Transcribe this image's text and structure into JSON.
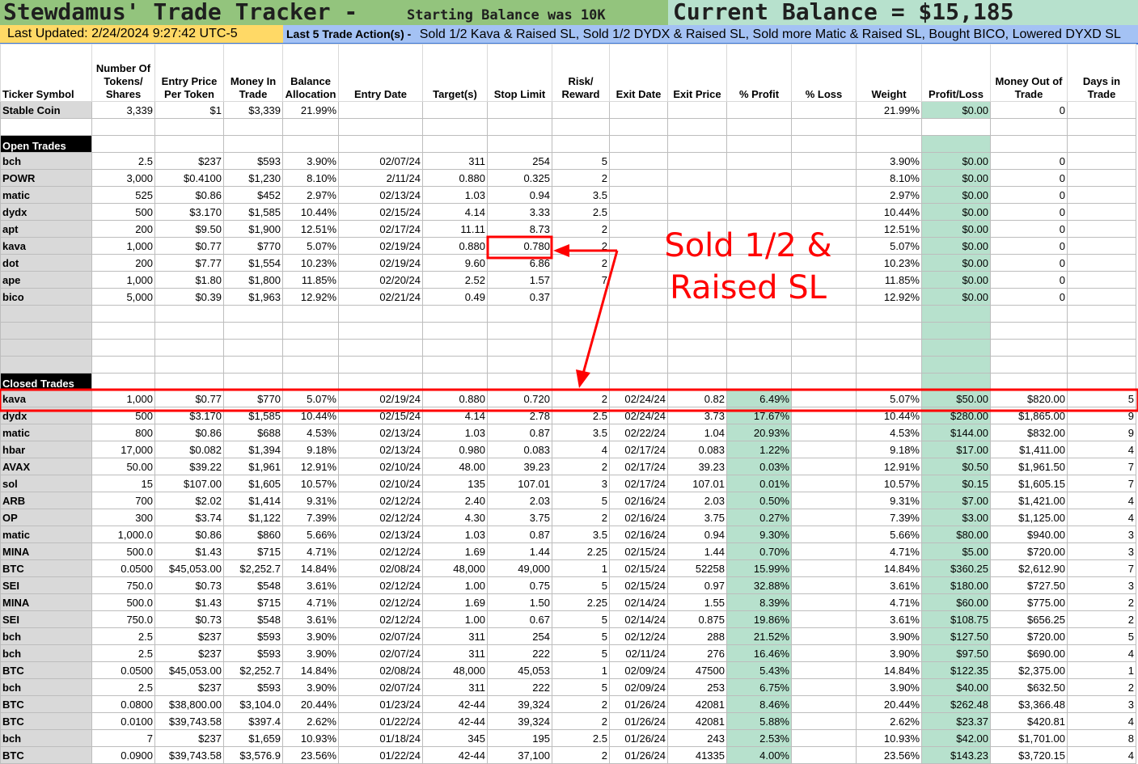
{
  "title": "Stewdamus' Trade Tracker -",
  "subtitle": "Starting Balance was 10K",
  "current_balance": "Current Balance = $15,185",
  "last_updated": "Last Updated:  2/24/2024 9:27:42  UTC-5",
  "actions_label": "Last 5 Trade Action(s) -",
  "actions_text": "Sold 1/2 Kava & Raised SL, Sold 1/2 DYDX & Raised SL, Sold more Matic & Raised SL, Bought BICO, Lowered DYXD SL",
  "annotation": "Sold 1/2 & Raised SL",
  "colors": {
    "title_bg": "#93c47d",
    "balance_bg": "#b7e1cd",
    "updated_bg": "#ffd966",
    "actions_bg": "#a4c2f4",
    "profit_bg": "#b7e1cd",
    "annotation": "#ff0000"
  },
  "headers": [
    "Ticker Symbol",
    "Number Of Tokens/ Shares",
    "Entry Price Per Token",
    "Money In Trade",
    "Balance Allocation",
    "Entry Date",
    "Target(s)",
    "Stop Limit",
    "Risk/ Reward",
    "Exit Date",
    "Exit Price",
    "% Profit",
    "% Loss",
    "Weight",
    "Profit/Loss",
    "Money Out of Trade",
    "Days in Trade"
  ],
  "stable": [
    "Stable Coin",
    "3,339",
    "$1",
    "$3,339",
    "21.99%",
    "",
    "",
    "",
    "",
    "",
    "",
    "",
    "",
    "21.99%",
    "$0.00",
    "0",
    ""
  ],
  "open_label": "Open Trades",
  "open_trades": [
    [
      "bch",
      "2.5",
      "$237",
      "$593",
      "3.90%",
      "02/07/24",
      "311",
      "254",
      "5",
      "",
      "",
      "",
      "",
      "3.90%",
      "$0.00",
      "0",
      ""
    ],
    [
      "POWR",
      "3,000",
      "$0.4100",
      "$1,230",
      "8.10%",
      "2/11/24",
      "0.880",
      "0.325",
      "2",
      "",
      "",
      "",
      "",
      "8.10%",
      "$0.00",
      "0",
      ""
    ],
    [
      "matic",
      "525",
      "$0.86",
      "$452",
      "2.97%",
      "02/13/24",
      "1.03",
      "0.94",
      "3.5",
      "",
      "",
      "",
      "",
      "2.97%",
      "$0.00",
      "0",
      ""
    ],
    [
      "dydx",
      "500",
      "$3.170",
      "$1,585",
      "10.44%",
      "02/15/24",
      "4.14",
      "3.33",
      "2.5",
      "",
      "",
      "",
      "",
      "10.44%",
      "$0.00",
      "0",
      ""
    ],
    [
      "apt",
      "200",
      "$9.50",
      "$1,900",
      "12.51%",
      "02/17/24",
      "11.11",
      "8.73",
      "2",
      "",
      "",
      "",
      "",
      "12.51%",
      "$0.00",
      "0",
      ""
    ],
    [
      "kava",
      "1,000",
      "$0.77",
      "$770",
      "5.07%",
      "02/19/24",
      "0.880",
      "0.780",
      "2",
      "",
      "",
      "",
      "",
      "5.07%",
      "$0.00",
      "0",
      ""
    ],
    [
      "dot",
      "200",
      "$7.77",
      "$1,554",
      "10.23%",
      "02/19/24",
      "9.60",
      "6.86",
      "2",
      "",
      "",
      "",
      "",
      "10.23%",
      "$0.00",
      "0",
      ""
    ],
    [
      "ape",
      "1,000",
      "$1.80",
      "$1,800",
      "11.85%",
      "02/20/24",
      "2.52",
      "1.57",
      "7",
      "",
      "",
      "",
      "",
      "11.85%",
      "$0.00",
      "0",
      ""
    ],
    [
      "bico",
      "5,000",
      "$0.39",
      "$1,963",
      "12.92%",
      "02/21/24",
      "0.49",
      "0.37",
      "",
      "",
      "",
      "",
      "",
      "12.92%",
      "$0.00",
      "0",
      ""
    ]
  ],
  "closed_label": "Closed Trades",
  "closed_trades": [
    [
      "kava",
      "1,000",
      "$0.77",
      "$770",
      "5.07%",
      "02/19/24",
      "0.880",
      "0.720",
      "2",
      "02/24/24",
      "0.82",
      "6.49%",
      "",
      "5.07%",
      "$50.00",
      "$820.00",
      "5"
    ],
    [
      "dydx",
      "500",
      "$3.170",
      "$1,585",
      "10.44%",
      "02/15/24",
      "4.14",
      "2.78",
      "2.5",
      "02/24/24",
      "3.73",
      "17.67%",
      "",
      "10.44%",
      "$280.00",
      "$1,865.00",
      "9"
    ],
    [
      "matic",
      "800",
      "$0.86",
      "$688",
      "4.53%",
      "02/13/24",
      "1.03",
      "0.87",
      "3.5",
      "02/22/24",
      "1.04",
      "20.93%",
      "",
      "4.53%",
      "$144.00",
      "$832.00",
      "9"
    ],
    [
      "hbar",
      "17,000",
      "$0.082",
      "$1,394",
      "9.18%",
      "02/13/24",
      "0.980",
      "0.083",
      "4",
      "02/17/24",
      "0.083",
      "1.22%",
      "",
      "9.18%",
      "$17.00",
      "$1,411.00",
      "4"
    ],
    [
      "AVAX",
      "50.00",
      "$39.22",
      "$1,961",
      "12.91%",
      "02/10/24",
      "48.00",
      "39.23",
      "2",
      "02/17/24",
      "39.23",
      "0.03%",
      "",
      "12.91%",
      "$0.50",
      "$1,961.50",
      "7"
    ],
    [
      "sol",
      "15",
      "$107.00",
      "$1,605",
      "10.57%",
      "02/10/24",
      "135",
      "107.01",
      "3",
      "02/17/24",
      "107.01",
      "0.01%",
      "",
      "10.57%",
      "$0.15",
      "$1,605.15",
      "7"
    ],
    [
      "ARB",
      "700",
      "$2.02",
      "$1,414",
      "9.31%",
      "02/12/24",
      "2.40",
      "2.03",
      "5",
      "02/16/24",
      "2.03",
      "0.50%",
      "",
      "9.31%",
      "$7.00",
      "$1,421.00",
      "4"
    ],
    [
      "OP",
      "300",
      "$3.74",
      "$1,122",
      "7.39%",
      "02/12/24",
      "4.30",
      "3.75",
      "2",
      "02/16/24",
      "3.75",
      "0.27%",
      "",
      "7.39%",
      "$3.00",
      "$1,125.00",
      "4"
    ],
    [
      "matic",
      "1,000.0",
      "$0.86",
      "$860",
      "5.66%",
      "02/13/24",
      "1.03",
      "0.87",
      "3.5",
      "02/16/24",
      "0.94",
      "9.30%",
      "",
      "5.66%",
      "$80.00",
      "$940.00",
      "3"
    ],
    [
      "MINA",
      "500.0",
      "$1.43",
      "$715",
      "4.71%",
      "02/12/24",
      "1.69",
      "1.44",
      "2.25",
      "02/15/24",
      "1.44",
      "0.70%",
      "",
      "4.71%",
      "$5.00",
      "$720.00",
      "3"
    ],
    [
      "BTC",
      "0.0500",
      "$45,053.00",
      "$2,252.7",
      "14.84%",
      "02/08/24",
      "48,000",
      "49,000",
      "1",
      "02/15/24",
      "52258",
      "15.99%",
      "",
      "14.84%",
      "$360.25",
      "$2,612.90",
      "7"
    ],
    [
      "SEI",
      "750.0",
      "$0.73",
      "$548",
      "3.61%",
      "02/12/24",
      "1.00",
      "0.75",
      "5",
      "02/15/24",
      "0.97",
      "32.88%",
      "",
      "3.61%",
      "$180.00",
      "$727.50",
      "3"
    ],
    [
      "MINA",
      "500.0",
      "$1.43",
      "$715",
      "4.71%",
      "02/12/24",
      "1.69",
      "1.50",
      "2.25",
      "02/14/24",
      "1.55",
      "8.39%",
      "",
      "4.71%",
      "$60.00",
      "$775.00",
      "2"
    ],
    [
      "SEI",
      "750.0",
      "$0.73",
      "$548",
      "3.61%",
      "02/12/24",
      "1.00",
      "0.67",
      "5",
      "02/14/24",
      "0.875",
      "19.86%",
      "",
      "3.61%",
      "$108.75",
      "$656.25",
      "2"
    ],
    [
      "bch",
      "2.5",
      "$237",
      "$593",
      "3.90%",
      "02/07/24",
      "311",
      "254",
      "5",
      "02/12/24",
      "288",
      "21.52%",
      "",
      "3.90%",
      "$127.50",
      "$720.00",
      "5"
    ],
    [
      "bch",
      "2.5",
      "$237",
      "$593",
      "3.90%",
      "02/07/24",
      "311",
      "222",
      "5",
      "02/11/24",
      "276",
      "16.46%",
      "",
      "3.90%",
      "$97.50",
      "$690.00",
      "4"
    ],
    [
      "BTC",
      "0.0500",
      "$45,053.00",
      "$2,252.7",
      "14.84%",
      "02/08/24",
      "48,000",
      "45,053",
      "1",
      "02/09/24",
      "47500",
      "5.43%",
      "",
      "14.84%",
      "$122.35",
      "$2,375.00",
      "1"
    ],
    [
      "bch",
      "2.5",
      "$237",
      "$593",
      "3.90%",
      "02/07/24",
      "311",
      "222",
      "5",
      "02/09/24",
      "253",
      "6.75%",
      "",
      "3.90%",
      "$40.00",
      "$632.50",
      "2"
    ],
    [
      "BTC",
      "0.0800",
      "$38,800.00",
      "$3,104.0",
      "20.44%",
      "01/23/24",
      "42-44",
      "39,324",
      "2",
      "01/26/24",
      "42081",
      "8.46%",
      "",
      "20.44%",
      "$262.48",
      "$3,366.48",
      "3"
    ],
    [
      "BTC",
      "0.0100",
      "$39,743.58",
      "$397.4",
      "2.62%",
      "01/22/24",
      "42-44",
      "39,324",
      "2",
      "01/26/24",
      "42081",
      "5.88%",
      "",
      "2.62%",
      "$23.37",
      "$420.81",
      "4"
    ],
    [
      "bch",
      "7",
      "$237",
      "$1,659",
      "10.93%",
      "01/18/24",
      "345",
      "195",
      "2.5",
      "01/26/24",
      "243",
      "2.53%",
      "",
      "10.93%",
      "$42.00",
      "$1,701.00",
      "8"
    ],
    [
      "BTC",
      "0.0900",
      "$39,743.58",
      "$3,576.9",
      "23.56%",
      "01/22/24",
      "42-44",
      "37,100",
      "2",
      "01/26/24",
      "41335",
      "4.00%",
      "",
      "23.56%",
      "$143.23",
      "$3,720.15",
      "4"
    ]
  ]
}
